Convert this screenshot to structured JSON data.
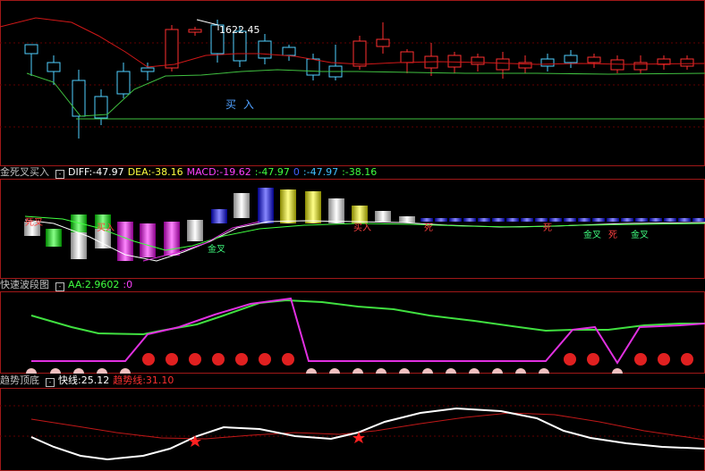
{
  "price_panel": {
    "high_label": "1622.45",
    "buy_label": "买 入"
  },
  "macd_panel": {
    "title": "金死叉买入",
    "diff": "DIFF:-47.97",
    "dea": "DEA:-38.16",
    "macd": "MACD:-19.62",
    "extra1": ":-47.97",
    "extra2": "0",
    "extra3": ":-47.97",
    "extra4": ":-38.16",
    "markers": [
      "死叉",
      "买入",
      "金叉",
      "买入",
      "死",
      "死",
      "金叉",
      "死",
      "金叉"
    ]
  },
  "wave_panel": {
    "title": "快速波段图",
    "aa": "AA:2.9602",
    "zero": ":0"
  },
  "trend_panel": {
    "title": "趋势顶底",
    "fast_line": "快线:25.12",
    "trend_line": "趋势线:31.10"
  },
  "colors": {
    "frame": "#a01818",
    "up": "#ff3030",
    "down": "#50d0ff",
    "ma_red": "#d01818",
    "ma_green": "#40c040",
    "magenta": "#e030e0",
    "white": "#ffffff"
  },
  "icons": {
    "collapse": "collapse-toggle-icon",
    "star": "star-icon"
  }
}
